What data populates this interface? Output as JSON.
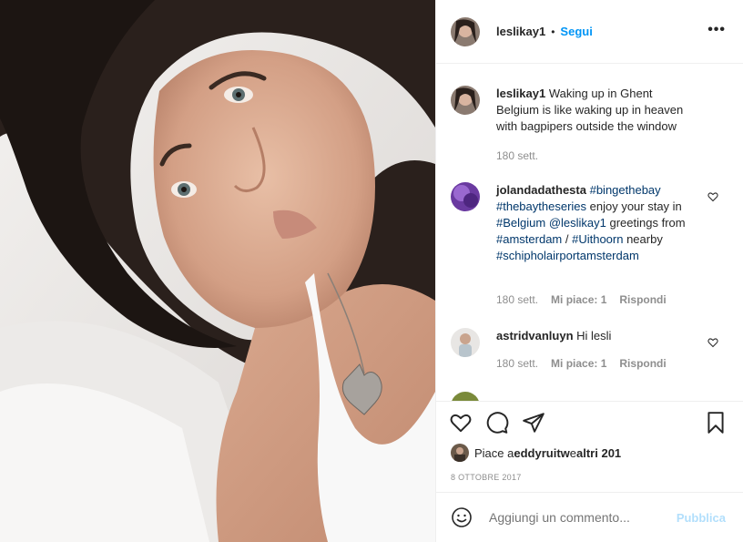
{
  "header": {
    "username": "leslikay1",
    "separator": "•",
    "follow_label": "Segui",
    "more_label": "•••"
  },
  "caption": {
    "username": "leslikay1",
    "text": "Waking up in Ghent Belgium is like waking up in heaven with bagpipers outside the window",
    "time": "180 sett."
  },
  "comments": [
    {
      "username": "jolandadathesta",
      "segments": [
        {
          "t": "#bingethebay",
          "tag": true
        },
        {
          "t": " ",
          "tag": false
        },
        {
          "t": "#thebaytheseries",
          "tag": true
        },
        {
          "t": " enjoy your stay in ",
          "tag": false
        },
        {
          "t": "#Belgium",
          "tag": true
        },
        {
          "t": " ",
          "tag": false
        },
        {
          "t": "@leslikay1",
          "tag": true
        },
        {
          "t": " greetings from ",
          "tag": false
        },
        {
          "t": "#amsterdam",
          "tag": true
        },
        {
          "t": " / ",
          "tag": false
        },
        {
          "t": "#Uithoorn",
          "tag": true
        },
        {
          "t": " nearby ",
          "tag": false
        },
        {
          "t": "#schipholairportamsterdam",
          "tag": true
        }
      ],
      "time": "180 sett.",
      "likes": "Mi piace: 1",
      "reply": "Rispondi"
    },
    {
      "username": "astridvanluyn",
      "text": "Hi lesli",
      "time": "180 sett.",
      "likes": "Mi piace: 1",
      "reply": "Rispondi"
    }
  ],
  "likes": {
    "prefix": "Piace a ",
    "user": "eddyruitw",
    "middle": " e ",
    "others": "altri 201"
  },
  "date": "8 OTTOBRE 2017",
  "add_comment": {
    "placeholder": "Aggiungi un commento...",
    "publish_label": "Pubblica"
  },
  "colors": {
    "link": "#00376b",
    "follow": "#0095f6",
    "publish_disabled": "#b2dffc",
    "muted": "#8e8e8e"
  },
  "icons": [
    "more-options-icon",
    "heart-icon",
    "comment-icon",
    "share-icon",
    "bookmark-icon",
    "emoji-icon"
  ]
}
